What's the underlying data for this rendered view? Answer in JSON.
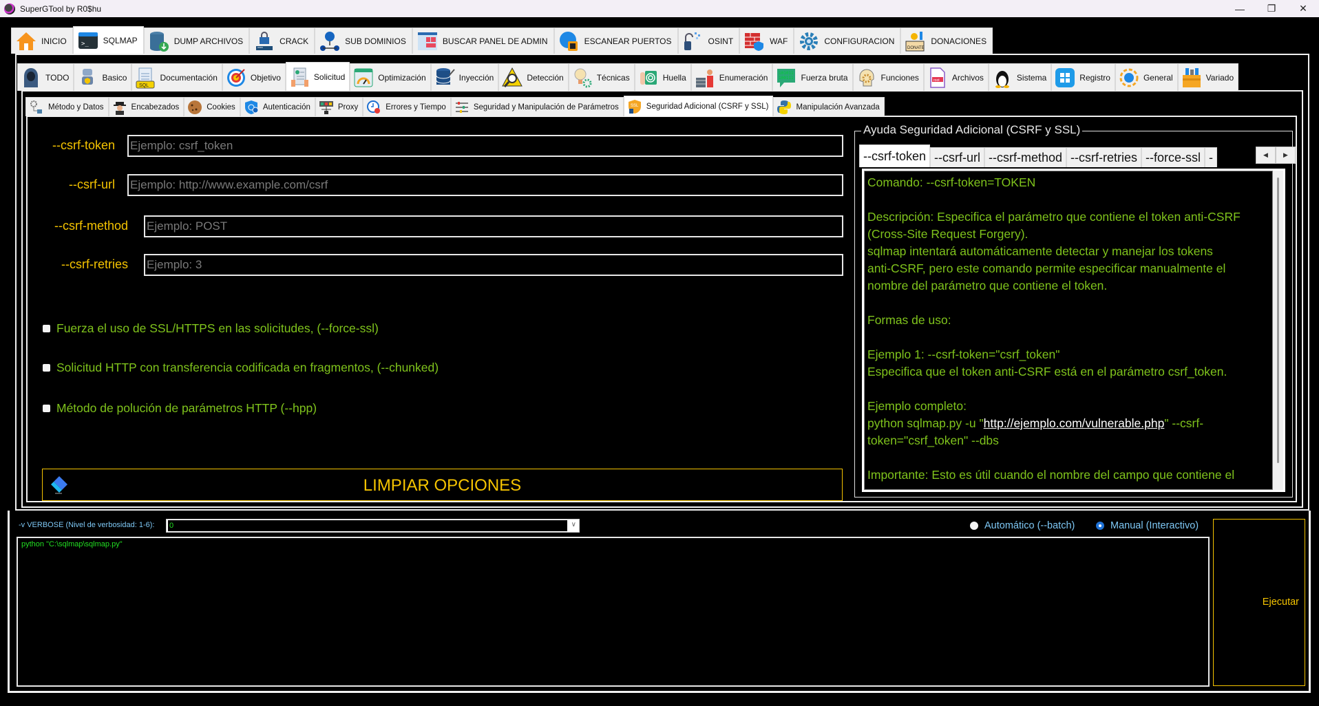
{
  "window": {
    "title": "SuperGTool by R0$hu",
    "controls": [
      "minimize",
      "maximize",
      "close"
    ]
  },
  "main_tabs": [
    {
      "label": "INICIO",
      "icon": "home-icon",
      "active": false
    },
    {
      "label": "SQLMAP",
      "icon": "terminal-icon",
      "active": true
    },
    {
      "label": "DUMP ARCHIVOS",
      "icon": "database-download-icon",
      "active": false
    },
    {
      "label": "CRACK",
      "icon": "password-lock-icon",
      "active": false
    },
    {
      "label": "SUB DOMINIOS",
      "icon": "network-globe-icon",
      "active": false
    },
    {
      "label": "BUSCAR PANEL DE ADMIN",
      "icon": "admin-panel-icon",
      "active": false
    },
    {
      "label": "ESCANEAR PUERTOS",
      "icon": "port-scan-icon",
      "active": false
    },
    {
      "label": "OSINT",
      "icon": "open-lock-icon",
      "active": false
    },
    {
      "label": "WAF",
      "icon": "firewall-icon",
      "active": false
    },
    {
      "label": "CONFIGURACION",
      "icon": "gear-icon",
      "active": false
    },
    {
      "label": "DONACIONES",
      "icon": "donate-box-icon",
      "active": false
    }
  ],
  "sqlmap_tabs": [
    {
      "label": "TODO",
      "icon": "hacker-icon",
      "active": false
    },
    {
      "label": "Basico",
      "icon": "robot-icon",
      "active": false
    },
    {
      "label": "Documentación",
      "icon": "sql-doc-icon",
      "active": false
    },
    {
      "label": "Objetivo",
      "icon": "target-icon",
      "active": false
    },
    {
      "label": "Solicitud",
      "icon": "request-form-icon",
      "active": true
    },
    {
      "label": "Optimización",
      "icon": "speedometer-icon",
      "active": false
    },
    {
      "label": "Inyección",
      "icon": "database-inject-icon",
      "active": false
    },
    {
      "label": "Detección",
      "icon": "warning-magnifier-icon",
      "active": false
    },
    {
      "label": "Técnicas",
      "icon": "lightbulb-gear-icon",
      "active": false
    },
    {
      "label": "Huella",
      "icon": "fingerprint-icon",
      "active": false
    },
    {
      "label": "Enumeración",
      "icon": "server-user-icon",
      "active": false
    },
    {
      "label": "Fuerza bruta",
      "icon": "binary-icon",
      "active": false
    },
    {
      "label": "Funciones",
      "icon": "head-gear-icon",
      "active": false
    },
    {
      "label": "Archivos",
      "icon": "root-file-icon",
      "active": false
    },
    {
      "label": "Sistema",
      "icon": "linux-penguin-icon",
      "active": false
    },
    {
      "label": "Registro",
      "icon": "windows-icon",
      "active": false
    },
    {
      "label": "General",
      "icon": "globe-cycle-icon",
      "active": false
    },
    {
      "label": "Variado",
      "icon": "toolbox-icon",
      "active": false
    }
  ],
  "solicitud_tabs": [
    {
      "label": "Método y Datos",
      "icon": "gear-network-icon",
      "active": false
    },
    {
      "label": "Encabezados",
      "icon": "spy-icon",
      "active": false
    },
    {
      "label": "Cookies",
      "icon": "cookie-icon",
      "active": false
    },
    {
      "label": "Autenticación",
      "icon": "fingerprint-shield-icon",
      "active": false
    },
    {
      "label": "Proxy",
      "icon": "proxy-icon",
      "active": false
    },
    {
      "label": "Errores y Tiempo",
      "icon": "clock-error-icon",
      "active": false
    },
    {
      "label": "Seguridad y Manipulación de Parámetros",
      "icon": "sliders-icon",
      "active": false
    },
    {
      "label": "Seguridad Adicional (CSRF y SSL)",
      "icon": "ssl-shield-icon",
      "active": true
    },
    {
      "label": "Manipulación Avanzada",
      "icon": "python-icon",
      "active": false
    }
  ],
  "form": {
    "fields": [
      {
        "label": "--csrf-token",
        "placeholder": "Ejemplo: csrf_token",
        "value": ""
      },
      {
        "label": "--csrf-url",
        "placeholder": "Ejemplo: http://www.example.com/csrf",
        "value": ""
      },
      {
        "label": "--csrf-method",
        "placeholder": "Ejemplo: POST",
        "value": ""
      },
      {
        "label": "--csrf-retries",
        "placeholder": "Ejemplo: 3",
        "value": ""
      }
    ],
    "checkboxes": [
      {
        "label": "Fuerza el uso de SSL/HTTPS en las solicitudes, (--force-ssl)",
        "checked": false
      },
      {
        "label": "Solicitud HTTP con transferencia codificada en fragmentos, (--chunked)",
        "checked": false
      },
      {
        "label": "Método de polución de parámetros HTTP (--hpp)",
        "checked": false
      }
    ],
    "clear_button": "LIMPIAR OPCIONES"
  },
  "help": {
    "title": "Ayuda Seguridad Adicional (CSRF y SSL)",
    "tabs": [
      "--csrf-token",
      "--csrf-url",
      "--csrf-method",
      "--csrf-retries",
      "--force-ssl",
      "-"
    ],
    "active_tab": "--csrf-token",
    "lines": [
      "Comando: --csrf-token=TOKEN",
      "",
      "Descripción: Especifica el parámetro que contiene el token anti-CSRF",
      "(Cross-Site Request Forgery).",
      "sqlmap intentará automáticamente detectar y manejar los tokens",
      "anti-CSRF, pero este comando permite especificar manualmente el",
      "nombre del parámetro que contiene el token.",
      "",
      "Formas de uso:",
      "",
      "Ejemplo 1: --csrf-token=\"csrf_token\"",
      "Especifica que el token anti-CSRF está en el parámetro csrf_token.",
      "",
      "Ejemplo completo:"
    ],
    "example_prefix": "python sqlmap.py -u \"",
    "example_link": "http://ejemplo.com/vulnerable.php",
    "example_suffix": "\" --csrf-",
    "example_line2": "token=\"csrf_token\" --dbs",
    "important": "Importante: Esto es útil cuando el nombre del campo que contiene el"
  },
  "bottom": {
    "verbose_label": "-v VERBOSE (Nivel de verbosidad: 1-6):",
    "verbose_value": "0",
    "radio_auto": "Automático (--batch)",
    "radio_manual": "Manual (Interactivo)",
    "mode_selected": "manual",
    "console_text": "python \"C:\\sqlmap\\sqlmap.py\"",
    "execute_button": "Ejecutar"
  },
  "colors": {
    "label_yellow": "#f5c400",
    "text_green": "#7fc31c",
    "console_green": "#22dd22",
    "info_blue": "#7ec8f5"
  }
}
